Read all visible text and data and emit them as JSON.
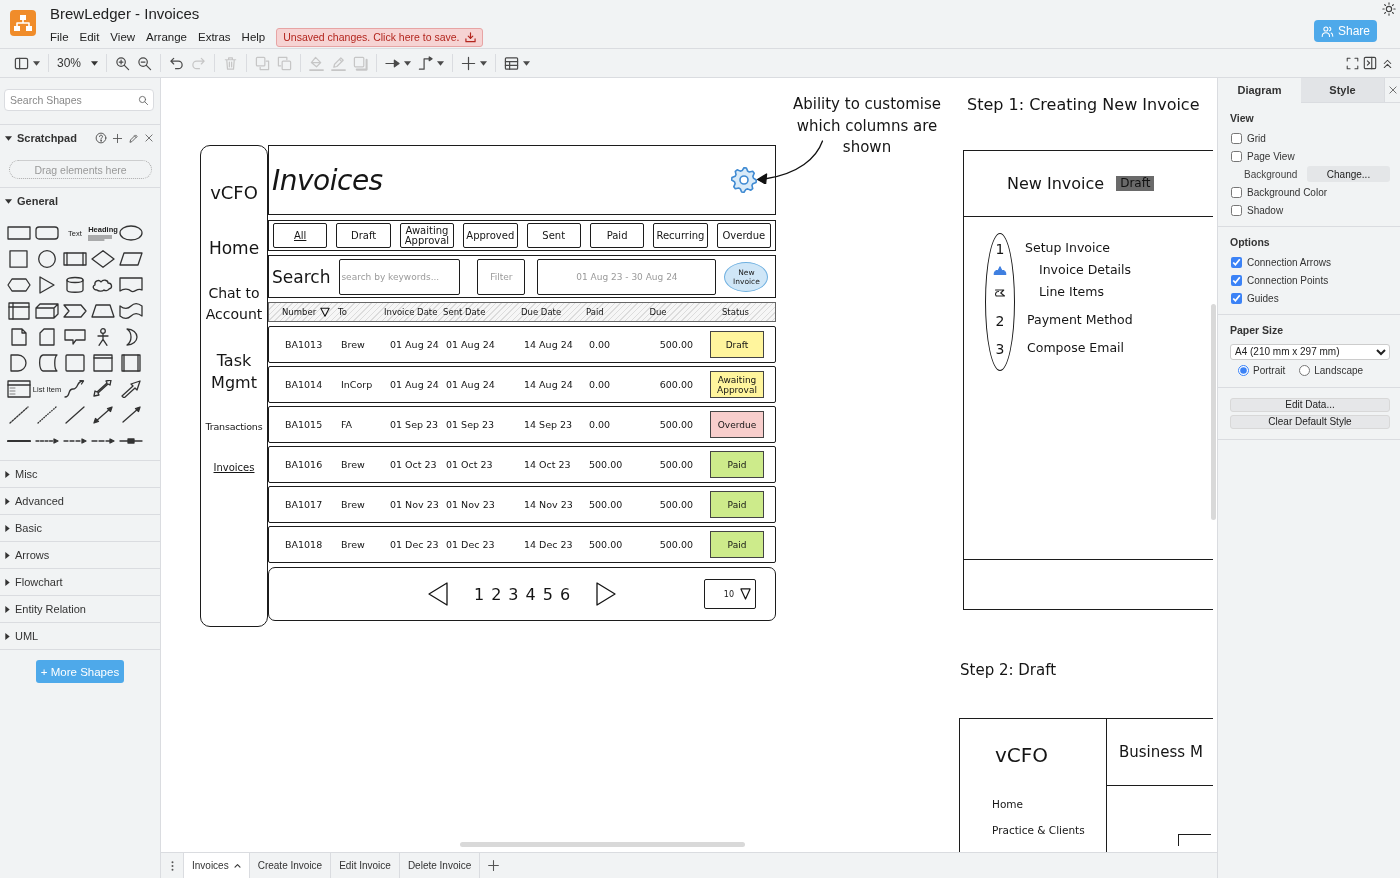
{
  "window": {
    "title": "BrewLedger - Invoices",
    "menu": [
      "File",
      "Edit",
      "View",
      "Arrange",
      "Extras",
      "Help"
    ],
    "save_notice": "Unsaved changes. Click here to save.",
    "share_button": "Share"
  },
  "toolbar": {
    "zoom": "30%",
    "groups": [
      [
        {
          "kind": "sidebar",
          "disabled": false
        }
      ],
      [
        {
          "kind": "zoom",
          "disabled": false
        }
      ],
      [
        {
          "kind": "zoom-in",
          "disabled": false
        },
        {
          "kind": "zoom-out",
          "disabled": false
        }
      ],
      [
        {
          "kind": "undo",
          "disabled": false
        },
        {
          "kind": "redo",
          "disabled": true
        }
      ],
      [
        {
          "kind": "delete",
          "disabled": true
        }
      ],
      [
        {
          "kind": "to-front",
          "disabled": true
        },
        {
          "kind": "to-back",
          "disabled": true
        }
      ],
      [
        {
          "kind": "fill-color",
          "disabled": true
        },
        {
          "kind": "line-color",
          "disabled": true
        },
        {
          "kind": "shadow",
          "disabled": true
        }
      ],
      [
        {
          "kind": "connection",
          "disabled": false
        },
        {
          "kind": "waypoints",
          "disabled": false
        }
      ],
      [
        {
          "kind": "insert",
          "disabled": false
        }
      ],
      [
        {
          "kind": "table",
          "disabled": false
        }
      ]
    ]
  },
  "sidebar": {
    "search": {
      "placeholder": "Search Shapes"
    },
    "scratchpad": {
      "title": "Scratchpad",
      "expanded": true,
      "hint": "Drag elements here"
    },
    "palettes": [
      {
        "title": "General",
        "expanded": true,
        "shape_labels": [
          "Text",
          "Heading",
          "List Item"
        ]
      },
      {
        "title": "Misc",
        "expanded": false
      },
      {
        "title": "Advanced",
        "expanded": false
      },
      {
        "title": "Basic",
        "expanded": false
      },
      {
        "title": "Arrows",
        "expanded": false
      },
      {
        "title": "Flowchart",
        "expanded": false
      },
      {
        "title": "Entity Relation",
        "expanded": false
      },
      {
        "title": "UML",
        "expanded": false
      }
    ],
    "more_shapes": "+ More Shapes"
  },
  "canvas": {
    "note": "Ability to customise\nwhich columns are\nshown",
    "invoices_mockup": {
      "brand": "vCFO",
      "nav": [
        {
          "label": "Home",
          "selected": false
        },
        {
          "label": "Chat to Account",
          "selected": false
        },
        {
          "label": "Task Mgmt",
          "selected": false
        },
        {
          "label": "Transactions",
          "selected": false
        },
        {
          "label": "Invoices",
          "selected": true
        }
      ],
      "title": "Invoices",
      "filters": [
        {
          "label": "All",
          "selected": true
        },
        {
          "label": "Draft",
          "selected": false
        },
        {
          "label": "Awaiting Approval",
          "selected": false
        },
        {
          "label": "Approved",
          "selected": false
        },
        {
          "label": "Sent",
          "selected": false
        },
        {
          "label": "Paid",
          "selected": false
        },
        {
          "label": "Recurring",
          "selected": false
        },
        {
          "label": "Overdue",
          "selected": false
        }
      ],
      "search": {
        "label": "Search",
        "placeholder": "search by keywords...",
        "filter_button": "Filter",
        "date_range": "01 Aug 23 - 30 Aug 24",
        "new_button": "New Invoice"
      },
      "columns": [
        "Number",
        "To",
        "Invoice Date",
        "Sent Date",
        "Due Date",
        "Paid",
        "Due",
        "Status"
      ],
      "rows": [
        {
          "number": "BA1013",
          "to": "Brew",
          "invoice_date": "01 Aug 24",
          "sent_date": "01 Aug 24",
          "due_date": "14 Aug 24",
          "paid": "0.00",
          "due": "500.00",
          "status": {
            "label": "Draft",
            "color": "#fff59d"
          }
        },
        {
          "number": "BA1014",
          "to": "InCorp",
          "invoice_date": "01 Aug 24",
          "sent_date": "01 Aug 24",
          "due_date": "14 Aug 24",
          "paid": "0.00",
          "due": "600.00",
          "status": {
            "label": "Awaiting Approval",
            "color": "#fff59d"
          }
        },
        {
          "number": "BA1015",
          "to": "FA",
          "invoice_date": "01 Sep 23",
          "sent_date": "01 Sep 23",
          "due_date": "14 Sep 23",
          "paid": "0.00",
          "due": "500.00",
          "status": {
            "label": "Overdue",
            "color": "#f8cecc"
          }
        },
        {
          "number": "BA1016",
          "to": "Brew",
          "invoice_date": "01 Oct 23",
          "sent_date": "01 Oct 23",
          "due_date": "14 Oct 23",
          "paid": "500.00",
          "due": "500.00",
          "status": {
            "label": "Paid",
            "color": "#cdeb8b"
          }
        },
        {
          "number": "BA1017",
          "to": "Brew",
          "invoice_date": "01 Nov 23",
          "sent_date": "01 Nov 23",
          "due_date": "14 Nov 23",
          "paid": "500.00",
          "due": "500.00",
          "status": {
            "label": "Paid",
            "color": "#cdeb8b"
          }
        },
        {
          "number": "BA1018",
          "to": "Brew",
          "invoice_date": "01 Dec 23",
          "sent_date": "01 Dec 23",
          "due_date": "14 Dec 23",
          "paid": "500.00",
          "due": "500.00",
          "status": {
            "label": "Paid",
            "color": "#cdeb8b"
          }
        }
      ],
      "pagination": {
        "pages": [
          "1",
          "2",
          "3",
          "4",
          "5",
          "6"
        ],
        "page_size": "10"
      }
    },
    "step_1": {
      "heading": "Step 1: Creating New Invoice",
      "title": "New Invoice",
      "badge": "Draft",
      "steps": [
        {
          "number": "1",
          "label": "Setup Invoice",
          "children": [
            {
              "label": "Invoice Details",
              "selected": true
            },
            {
              "label": "Line Items",
              "selected": false
            }
          ]
        },
        {
          "number": "2",
          "label": "Payment Method"
        },
        {
          "number": "3",
          "label": "Compose Email"
        }
      ]
    },
    "step_2": {
      "heading": "Step 2: Draft",
      "brand": "vCFO",
      "nav": [
        "Home",
        "Practice & Clients"
      ],
      "title": "Business M"
    }
  },
  "format_panel": {
    "tabs": [
      {
        "label": "Diagram",
        "selected": true
      },
      {
        "label": "Style",
        "selected": false
      }
    ],
    "sections": [
      {
        "title": "View",
        "items": [
          {
            "kind": "checkbox",
            "label": "Grid",
            "checked": false
          },
          {
            "kind": "checkbox",
            "label": "Page View",
            "checked": false
          },
          {
            "kind": "button-row",
            "label": "Background",
            "button": "Change..."
          },
          {
            "kind": "checkbox",
            "label": "Background Color",
            "checked": false
          },
          {
            "kind": "checkbox",
            "label": "Shadow",
            "checked": false
          }
        ]
      },
      {
        "title": "Options",
        "items": [
          {
            "kind": "checkbox",
            "label": "Connection Arrows",
            "checked": true
          },
          {
            "kind": "checkbox",
            "label": "Connection Points",
            "checked": true
          },
          {
            "kind": "checkbox",
            "label": "Guides",
            "checked": true
          }
        ]
      },
      {
        "title": "Paper Size",
        "items": [
          {
            "kind": "select",
            "value": "A4 (210 mm x 297 mm)"
          },
          {
            "kind": "radios",
            "options": [
              {
                "label": "Portrait",
                "selected": true
              },
              {
                "label": "Landscape",
                "selected": false
              }
            ]
          }
        ]
      },
      {
        "items": [
          {
            "kind": "button",
            "label": "Edit Data..."
          },
          {
            "kind": "button",
            "label": "Clear Default Style"
          }
        ]
      }
    ]
  },
  "page_tabs": [
    {
      "label": "Invoices",
      "selected": true
    },
    {
      "label": "Create Invoice",
      "selected": false
    },
    {
      "label": "Edit Invoice",
      "selected": false
    },
    {
      "label": "Delete Invoice",
      "selected": false
    }
  ]
}
